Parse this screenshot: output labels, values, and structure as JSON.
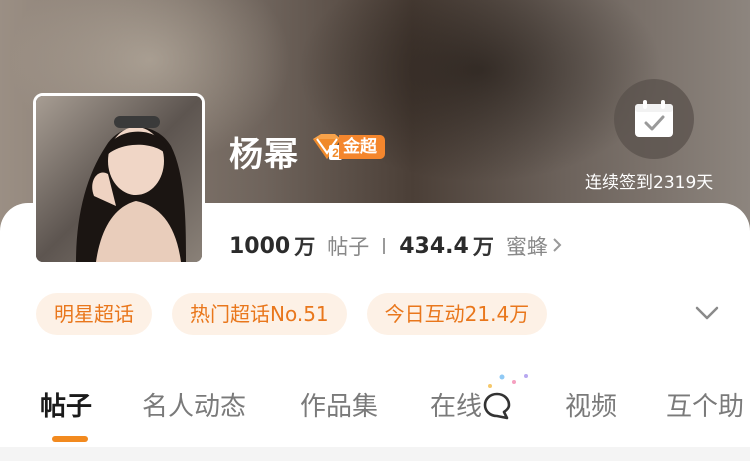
{
  "profile": {
    "name": "杨幂",
    "badge_level": "2",
    "badge_label": "金超",
    "checkin_text": "连续签到2319天"
  },
  "stats": {
    "posts_value": "1000",
    "posts_unit": "万",
    "posts_label": "帖子",
    "fans_value": "434.4",
    "fans_unit": "万",
    "fans_label": "蜜蜂"
  },
  "tags": [
    "明星超话",
    "热门超话No.51",
    "今日互动21.4万"
  ],
  "tabs": [
    "帖子",
    "名人动态",
    "作品集",
    "在线",
    "视频",
    "互个助"
  ],
  "active_tab": "帖子",
  "colors": {
    "accent": "#f28a1f",
    "tag_bg": "#fdf1e6",
    "tag_text": "#e9771c",
    "badge": "#f4862d"
  },
  "icons": {
    "checkin": "calendar-check-icon",
    "expand": "chevron-down-icon",
    "online": "chat-bubble-icon",
    "stats_more": "chevron-right-icon"
  }
}
